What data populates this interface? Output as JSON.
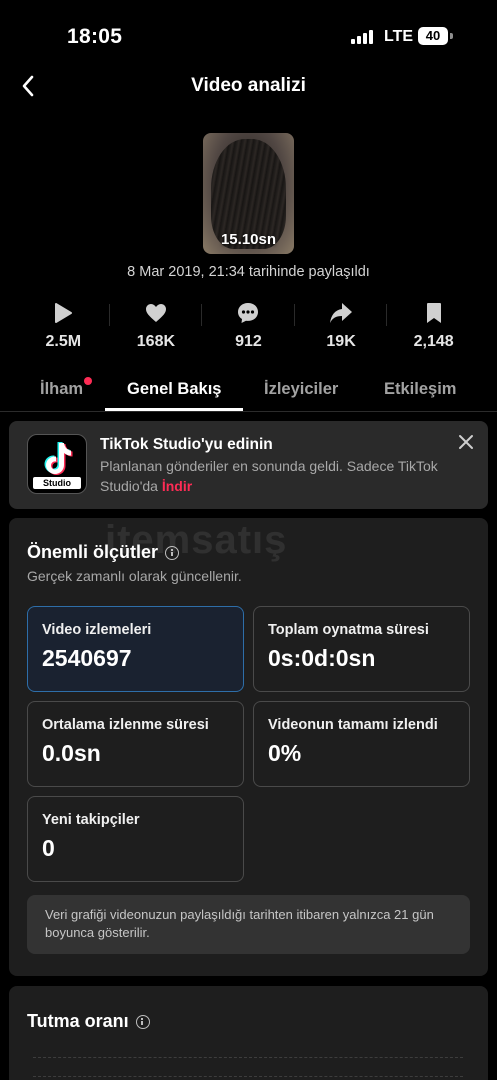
{
  "status": {
    "time": "18:05",
    "network": "LTE",
    "battery": "40"
  },
  "header": {
    "title": "Video analizi"
  },
  "video": {
    "duration": "15.10sn",
    "posted": "8 Mar 2019, 21:34 tarihinde paylaşıldı"
  },
  "stats": [
    {
      "icon": "play-icon",
      "value": "2.5M"
    },
    {
      "icon": "heart-icon",
      "value": "168K"
    },
    {
      "icon": "comment-icon",
      "value": "912"
    },
    {
      "icon": "share-icon",
      "value": "19K"
    },
    {
      "icon": "bookmark-icon",
      "value": "2,148"
    }
  ],
  "tabs": [
    {
      "label": "İlham",
      "active": false
    },
    {
      "label": "Genel Bakış",
      "active": true
    },
    {
      "label": "İzleyiciler",
      "active": false
    },
    {
      "label": "Etkileşim",
      "active": false
    }
  ],
  "promo": {
    "logo_text": "Studio",
    "title": "TikTok Studio'yu edinin",
    "body": "Planlanan gönderiler en sonunda geldi. Sadece TikTok Studio'da",
    "link": "İndir"
  },
  "watermark": "itemsatış",
  "key_metrics": {
    "title": "Önemli ölçütler",
    "subtitle": "Gerçek zamanlı olarak güncellenir.",
    "items": [
      {
        "label": "Video izlemeleri",
        "value": "2540697"
      },
      {
        "label": "Toplam oynatma süresi",
        "value": "0s:0d:0sn"
      },
      {
        "label": "Ortalama izlenme süresi",
        "value": "0.0sn"
      },
      {
        "label": "Videonun tamamı izlendi",
        "value": "0%"
      },
      {
        "label": "Yeni takipçiler",
        "value": "0"
      }
    ],
    "notice": "Veri grafiği videonuzun paylaşıldığı tarihten itibaren yalnızca 21 gün boyunca gösterilir."
  },
  "retention": {
    "title": "Tutma oranı"
  },
  "colors": {
    "accent": "#fe2c55",
    "selected_border": "#2e6ea8",
    "card_bg": "#1e1e1e"
  }
}
